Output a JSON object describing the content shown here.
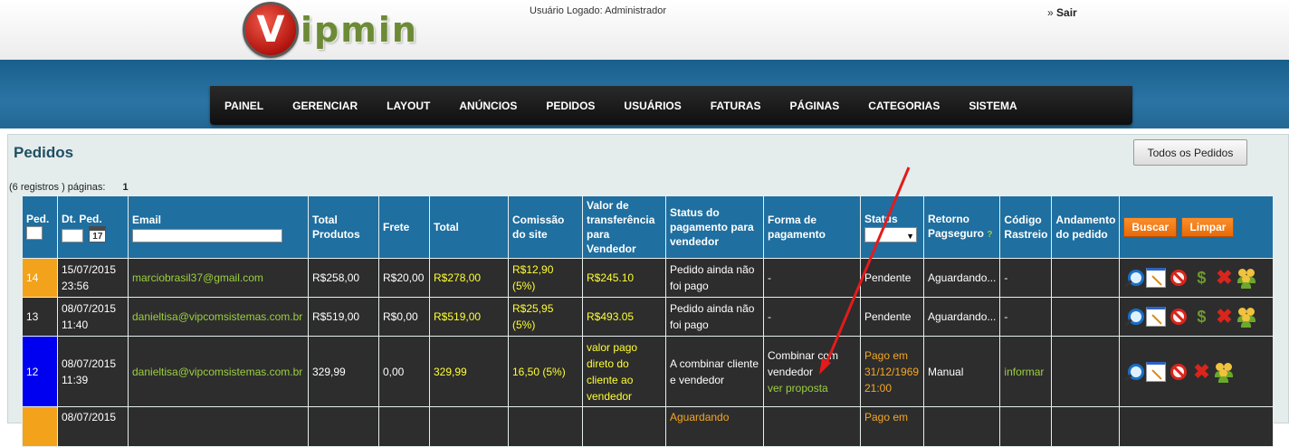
{
  "header": {
    "logo_letter": "V",
    "logo_rest": "ipmin",
    "logged_user": "Usuário Logado: Administrador",
    "logout_prefix": "»",
    "logout_label": "Sair"
  },
  "nav": [
    "PAINEL",
    "GERENCIAR",
    "LAYOUT",
    "ANÚNCIOS",
    "PEDIDOS",
    "USUÁRIOS",
    "FATURAS",
    "PÁGINAS",
    "CATEGORIAS",
    "SISTEMA"
  ],
  "page": {
    "title": "Pedidos",
    "all_orders_button": "Todos os Pedidos",
    "records_label": "(6 registros ) páginas:",
    "page_number": "1"
  },
  "table": {
    "headers": {
      "ped": "Ped.",
      "dt_ped": "Dt. Ped.",
      "calendar_day": "17",
      "email": "Email",
      "total_produtos": "Total Produtos",
      "frete": "Frete",
      "total": "Total",
      "comissao": "Comissão do site",
      "valor_transf": "Valor de transferência para Vendedor",
      "status_pag": "Status do pagamento para vendedor",
      "forma_pag": "Forma de pagamento",
      "status": "Status",
      "retorno": "Retorno Pagseguro",
      "help": "?",
      "rastreio": "Código Rastreio",
      "andamento": "Andamento do pedido",
      "buscar": "Buscar",
      "limpar": "Limpar"
    },
    "rows": [
      {
        "id": "14",
        "id_color": "orange",
        "date": "15/07/2015",
        "time": "23:56",
        "email": "marciobrasil37@gmail.com",
        "total_produtos": "R$258,00",
        "frete": "R$20,00",
        "total": "R$278,00",
        "comissao": "R$12,90",
        "comissao_pct": "(5%)",
        "valor_transf": "R$245.10",
        "status_pag": "Pedido ainda não foi pago",
        "forma_pag": "-",
        "forma_link": "",
        "status": "Pendente",
        "retorno": "Aguardando...",
        "rastreio": "-",
        "andamento": ""
      },
      {
        "id": "13",
        "id_color": "plain",
        "date": "08/07/2015",
        "time": "11:40",
        "email": "danieltisa@vipcomsistemas.com.br",
        "total_produtos": "R$519,00",
        "frete": "R$0,00",
        "total": "R$519,00",
        "comissao": "R$25,95",
        "comissao_pct": "(5%)",
        "valor_transf": "R$493.05",
        "status_pag": "Pedido ainda não foi pago",
        "forma_pag": "-",
        "forma_link": "",
        "status": "Pendente",
        "retorno": "Aguardando...",
        "rastreio": "-",
        "andamento": ""
      },
      {
        "id": "12",
        "id_color": "blue",
        "date": "08/07/2015",
        "time": "11:39",
        "email": "danieltisa@vipcomsistemas.com.br",
        "total_produtos": "329,99",
        "frete": "0,00",
        "total": "329,99",
        "comissao": "16,50",
        "comissao_pct": "(5%)",
        "valor_transf": "valor pago direto do cliente ao vendedor",
        "status_pag": "A combinar cliente e vendedor",
        "forma_pag": "Combinar com vendedor",
        "forma_link": "ver proposta",
        "status": "Pago em 31/12/1969 21:00",
        "retorno": "Manual",
        "rastreio": "informar",
        "andamento": ""
      },
      {
        "id": "",
        "id_color": "orange",
        "date": "08/07/2015",
        "time": "",
        "email": "",
        "total_produtos": "",
        "frete": "",
        "total": "",
        "comissao": "",
        "comissao_pct": "",
        "valor_transf": "",
        "status_pag": "Aguardando",
        "forma_pag": "",
        "forma_link": "",
        "status": "Pago em",
        "retorno": "",
        "rastreio": "",
        "andamento": ""
      }
    ]
  },
  "colors": {
    "nav_bg": "#111111",
    "band_blue": "#246894",
    "header_blue": "#1f6fa0",
    "row_dark": "#2d2d2d",
    "id_orange": "#f3a21b",
    "id_blue": "#0000f0",
    "text_green": "#9ccf3f",
    "text_yellow": "#ffff33",
    "button_orange": "#e86a08",
    "arrow_red": "#e31b1b"
  },
  "icons": [
    "zoom-icon",
    "notepad-icon",
    "block-icon",
    "money-icon",
    "delete-icon",
    "users-icon"
  ]
}
